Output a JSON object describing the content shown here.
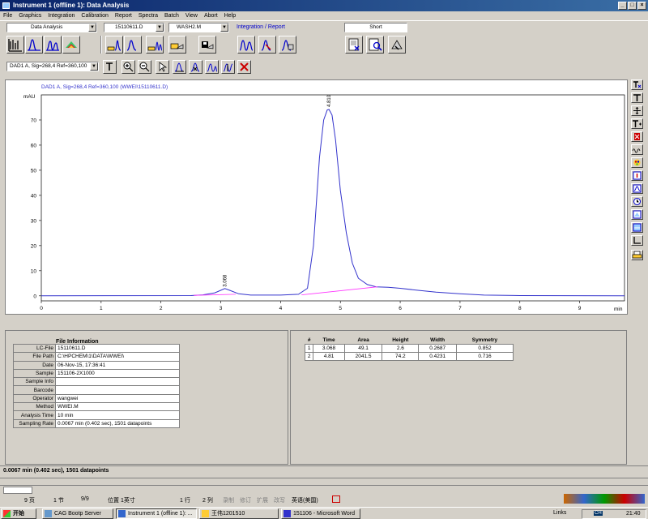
{
  "window": {
    "title": "Instrument 1 (offline 1): Data Analysis",
    "min": "_",
    "max": "□",
    "close": "×"
  },
  "menu": [
    "File",
    "Graphics",
    "Integration",
    "Calibration",
    "Report",
    "Spectra",
    "Batch",
    "View",
    "Abort",
    "Help"
  ],
  "toolbar": {
    "view_select": "Data Analysis",
    "data_file": "15110611.D",
    "method_file": "WASH2.M",
    "section_label": "Integration / Report",
    "report_style": "Short"
  },
  "signal_select": "DAD1 A, Sig=268,4 Ref=360,100",
  "chart_data": {
    "type": "line",
    "title": "DAD1 A, Sig=268,4 Ref=360,100 (WWEI\\15110611.D)",
    "ylabel": "mAU",
    "xlabel": "min",
    "xlim": [
      0,
      9.75
    ],
    "ylim": [
      -2,
      80
    ],
    "x_ticks": [
      0,
      1,
      2,
      3,
      4,
      5,
      6,
      7,
      8,
      9
    ],
    "y_ticks": [
      0,
      10,
      20,
      30,
      40,
      50,
      60,
      70
    ],
    "peaks": [
      {
        "rt": 3.068,
        "label": "3.068",
        "height": 2.6
      },
      {
        "rt": 4.81,
        "label": "4.810",
        "height": 74.2
      }
    ],
    "series": [
      {
        "name": "",
        "color": "#3333cc",
        "x": [
          0,
          2.5,
          2.7,
          2.9,
          3.0,
          3.068,
          3.15,
          3.3,
          3.5,
          4.0,
          4.3,
          4.45,
          4.55,
          4.65,
          4.72,
          4.78,
          4.81,
          4.86,
          4.92,
          5.0,
          5.1,
          5.2,
          5.3,
          5.45,
          5.6,
          5.8,
          6.0,
          6.3,
          6.6,
          7.0,
          7.4,
          8.0,
          9.75
        ],
        "y": [
          0,
          0.1,
          0.4,
          1.2,
          2.2,
          2.9,
          2.2,
          0.8,
          0.3,
          0.3,
          0.6,
          3,
          20,
          55,
          70,
          74,
          74.2,
          72,
          62,
          42,
          25,
          13,
          7,
          4.5,
          3.6,
          3.4,
          3.0,
          2.2,
          1.5,
          0.8,
          0.3,
          0.1,
          0
        ]
      },
      {
        "name": "",
        "color": "#ff33ff",
        "x": [
          2.55,
          3.25
        ],
        "y": [
          0.2,
          0.6
        ]
      },
      {
        "name": "",
        "color": "#ff33ff",
        "x": [
          4.35,
          5.62
        ],
        "y": [
          0.4,
          3.6
        ]
      }
    ]
  },
  "file_info": {
    "header": "File Information",
    "rows": [
      {
        "k": "LC-File",
        "v": "15110611.D"
      },
      {
        "k": "File Path",
        "v": "C:\\HPCHEM\\1\\DATA\\WWEI\\"
      },
      {
        "k": "Date",
        "v": "06-Nov-15, 17:36:41"
      },
      {
        "k": "Sample",
        "v": "151106-2X1000"
      },
      {
        "k": "Sample Info",
        "v": ""
      },
      {
        "k": "Barcode",
        "v": ""
      },
      {
        "k": "Operator",
        "v": "wangwei"
      },
      {
        "k": "Method",
        "v": "WWEI.M"
      },
      {
        "k": "Analysis Time",
        "v": "10 min"
      },
      {
        "k": "Sampling Rate",
        "v": "0.0067 min  (0.402 sec),  1501 datapoints"
      }
    ]
  },
  "peak_table": {
    "headers": [
      "#",
      "Time",
      "Area",
      "Height",
      "Width",
      "Symmetry"
    ],
    "rows": [
      [
        "1",
        "3.068",
        "49.1",
        "2.6",
        "0.2687",
        "0.852"
      ],
      [
        "2",
        "4.81",
        "2041.5",
        "74.2",
        "0.4231",
        "0.716"
      ]
    ]
  },
  "status": "0.0067 min  (0.402 sec),  1501 datapoints",
  "word_status": [
    "9 页",
    "1 节",
    "9/9",
    "位置 1英寸",
    "1 行",
    "2 列",
    "录制",
    "修订",
    "扩展",
    "改写",
    "英语(美国)"
  ],
  "taskbar": {
    "start": "开始",
    "tasks": [
      "CAG Bootp Server",
      "Instrument 1 (offline 1): ...",
      "王伟1201510",
      "151106 - Microsoft Word"
    ],
    "links": "Links",
    "ime": "CH",
    "clock": "21:40"
  }
}
